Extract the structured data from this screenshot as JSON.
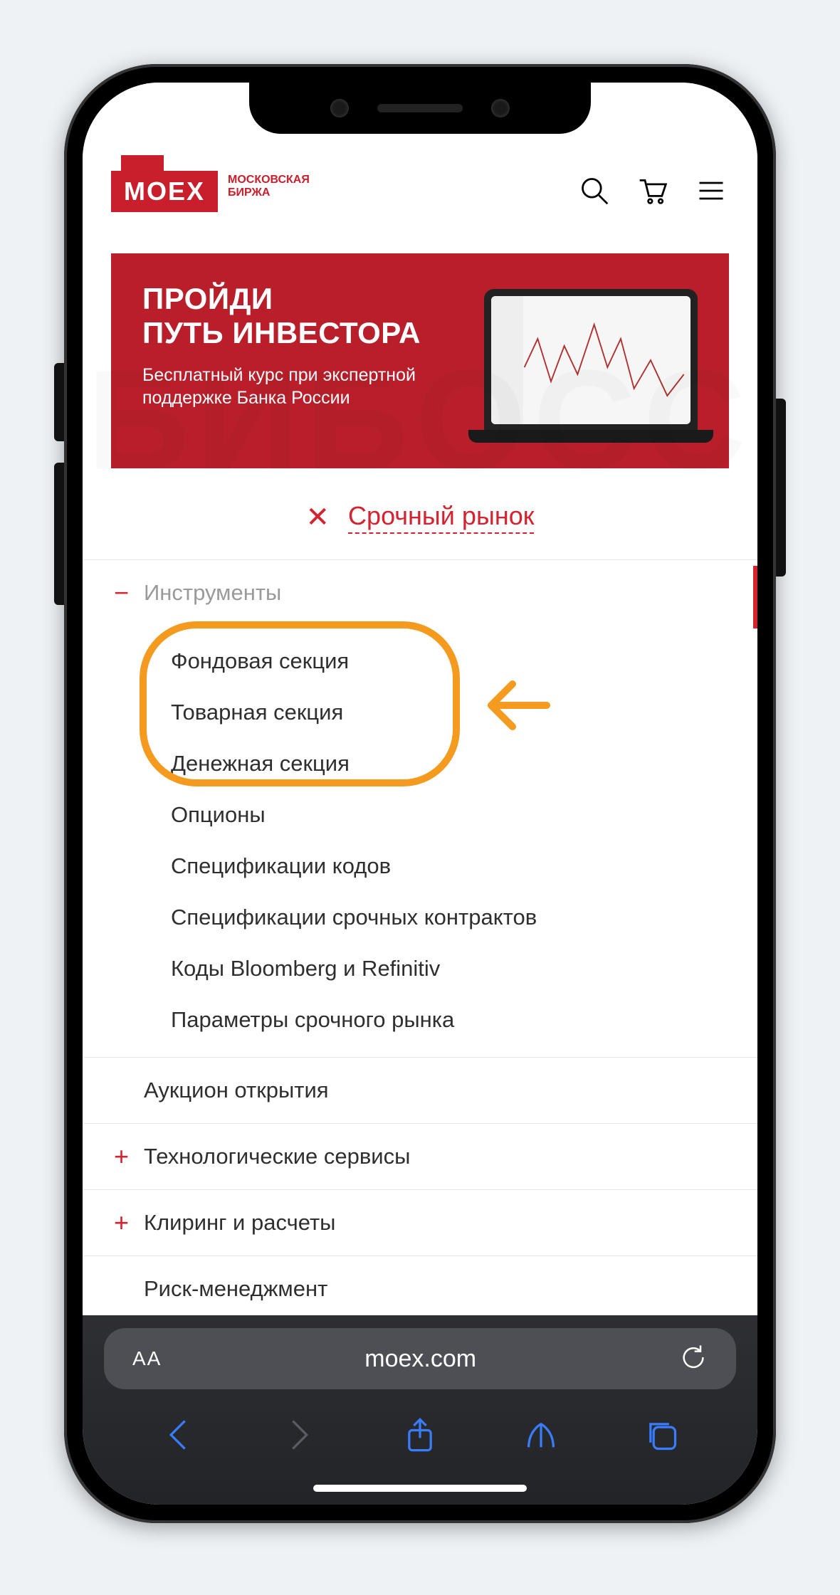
{
  "logo": {
    "mark": "MOEX",
    "tagline": "МОСКОВСКАЯ\nБИРЖА"
  },
  "banner": {
    "title_line1": "ПРОЙДИ",
    "title_line2": "ПУТЬ ИНВЕСТОРА",
    "subtitle": "Бесплатный курс при экспертной поддержке Банка России"
  },
  "crumb": {
    "label": "Срочный рынок"
  },
  "menu": {
    "expanded": {
      "label": "Инструменты",
      "children": [
        "Фондовая секция",
        "Товарная секция",
        "Денежная секция",
        "Опционы",
        "Спецификации кодов",
        "Спецификации срочных контрактов",
        "Коды Bloomberg и Refinitiv",
        "Параметры срочного рынка"
      ]
    },
    "rows": [
      {
        "sign": "",
        "label": "Аукцион открытия"
      },
      {
        "sign": "+",
        "label": "Технологические сервисы"
      },
      {
        "sign": "+",
        "label": "Клиринг и расчеты"
      },
      {
        "sign": "",
        "label": "Риск-менеджмент"
      }
    ]
  },
  "browser": {
    "text_size": "AА",
    "url": "moex.com"
  },
  "watermark": "БИБОСС"
}
